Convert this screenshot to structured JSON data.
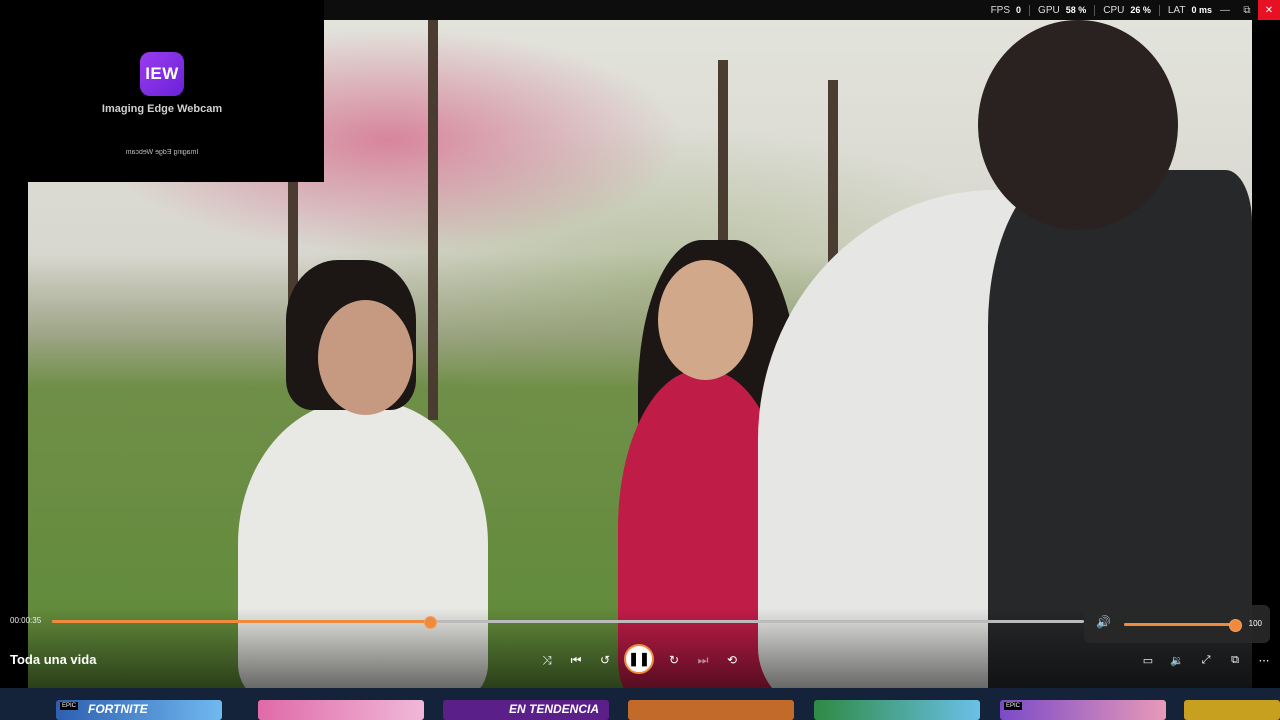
{
  "app_overlay": {
    "logo_text": "IEW",
    "name": "Imaging Edge Webcam",
    "mirrored_name": "Imaging Edge Webcam"
  },
  "stats": {
    "fps_label": "FPS",
    "fps_value": "0",
    "gpu_label": "GPU",
    "gpu_value": "58 %",
    "cpu_label": "CPU",
    "cpu_value": "26 %",
    "lat_label": "LAT",
    "lat_value": "0 ms"
  },
  "window_controls": {
    "minimize": "—",
    "restore": "⧉",
    "close": "✕"
  },
  "player": {
    "current_time": "00:00:35",
    "title": "Toda una vida",
    "progress": 0.365,
    "volume_value": "100",
    "volume_level": 0.98
  },
  "icons": {
    "shuffle": "shuffle-icon",
    "prev": "skip-previous-icon",
    "rewind": "rewind-10-icon",
    "play_pause": "pause-icon",
    "forward": "forward-30-icon",
    "next": "skip-next-icon",
    "repeat": "repeat-off-icon"
  },
  "taskbar": {
    "tiles": [
      {
        "label": "FORTNITE",
        "badge": "EPIC"
      },
      {
        "label": "",
        "badge": ""
      },
      {
        "label": "EN TENDENCIA",
        "badge": ""
      },
      {
        "label": "",
        "badge": ""
      },
      {
        "label": "",
        "badge": ""
      },
      {
        "label": "",
        "badge": "EPIC"
      }
    ]
  },
  "colors": {
    "accent": "#f08a3c",
    "logo_gradient_start": "#9b3cf0",
    "logo_gradient_end": "#6a22d8",
    "close": "#e81123"
  }
}
